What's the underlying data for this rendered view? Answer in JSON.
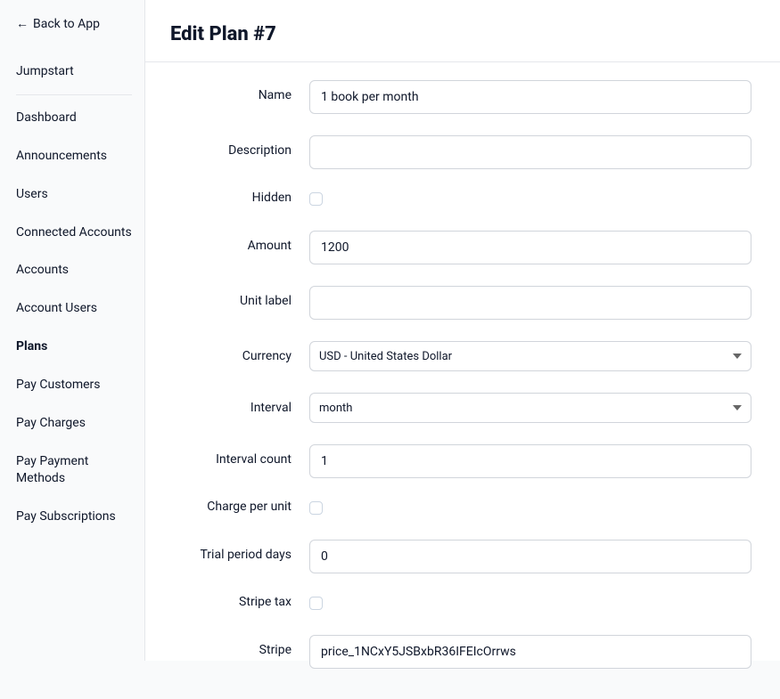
{
  "sidebar": {
    "back_label": "Back to App",
    "items": [
      {
        "label": "Jumpstart",
        "name": "sidebar-item-jumpstart",
        "active": false,
        "divider_after": true
      },
      {
        "label": "Dashboard",
        "name": "sidebar-item-dashboard",
        "active": false
      },
      {
        "label": "Announcements",
        "name": "sidebar-item-announcements",
        "active": false
      },
      {
        "label": "Users",
        "name": "sidebar-item-users",
        "active": false
      },
      {
        "label": "Connected Accounts",
        "name": "sidebar-item-connected-accounts",
        "active": false
      },
      {
        "label": "Accounts",
        "name": "sidebar-item-accounts",
        "active": false
      },
      {
        "label": "Account Users",
        "name": "sidebar-item-account-users",
        "active": false
      },
      {
        "label": "Plans",
        "name": "sidebar-item-plans",
        "active": true
      },
      {
        "label": "Pay Customers",
        "name": "sidebar-item-pay-customers",
        "active": false
      },
      {
        "label": "Pay Charges",
        "name": "sidebar-item-pay-charges",
        "active": false
      },
      {
        "label": "Pay Payment Methods",
        "name": "sidebar-item-pay-payment-methods",
        "active": false
      },
      {
        "label": "Pay Subscriptions",
        "name": "sidebar-item-pay-subscriptions",
        "active": false
      }
    ]
  },
  "page": {
    "title": "Edit Plan #7"
  },
  "form": {
    "fields": [
      {
        "label": "Name",
        "type": "text",
        "value": "1 book per month",
        "name": "name-field"
      },
      {
        "label": "Description",
        "type": "text",
        "value": "",
        "name": "description-field"
      },
      {
        "label": "Hidden",
        "type": "checkbox",
        "checked": false,
        "name": "hidden-checkbox"
      },
      {
        "label": "Amount",
        "type": "text",
        "value": "1200",
        "name": "amount-field"
      },
      {
        "label": "Unit label",
        "type": "text",
        "value": "",
        "name": "unit-label-field"
      },
      {
        "label": "Currency",
        "type": "select",
        "value": "USD - United States Dollar",
        "name": "currency-select"
      },
      {
        "label": "Interval",
        "type": "select",
        "value": "month",
        "name": "interval-select"
      },
      {
        "label": "Interval count",
        "type": "text",
        "value": "1",
        "name": "interval-count-field"
      },
      {
        "label": "Charge per unit",
        "type": "checkbox",
        "checked": false,
        "name": "charge-per-unit-checkbox"
      },
      {
        "label": "Trial period days",
        "type": "text",
        "value": "0",
        "name": "trial-period-days-field"
      },
      {
        "label": "Stripe tax",
        "type": "checkbox",
        "checked": false,
        "name": "stripe-tax-checkbox"
      },
      {
        "label": "Stripe",
        "type": "text",
        "value": "price_1NCxY5JSBxbR36IFEIcOrrws",
        "name": "stripe-field"
      }
    ]
  }
}
